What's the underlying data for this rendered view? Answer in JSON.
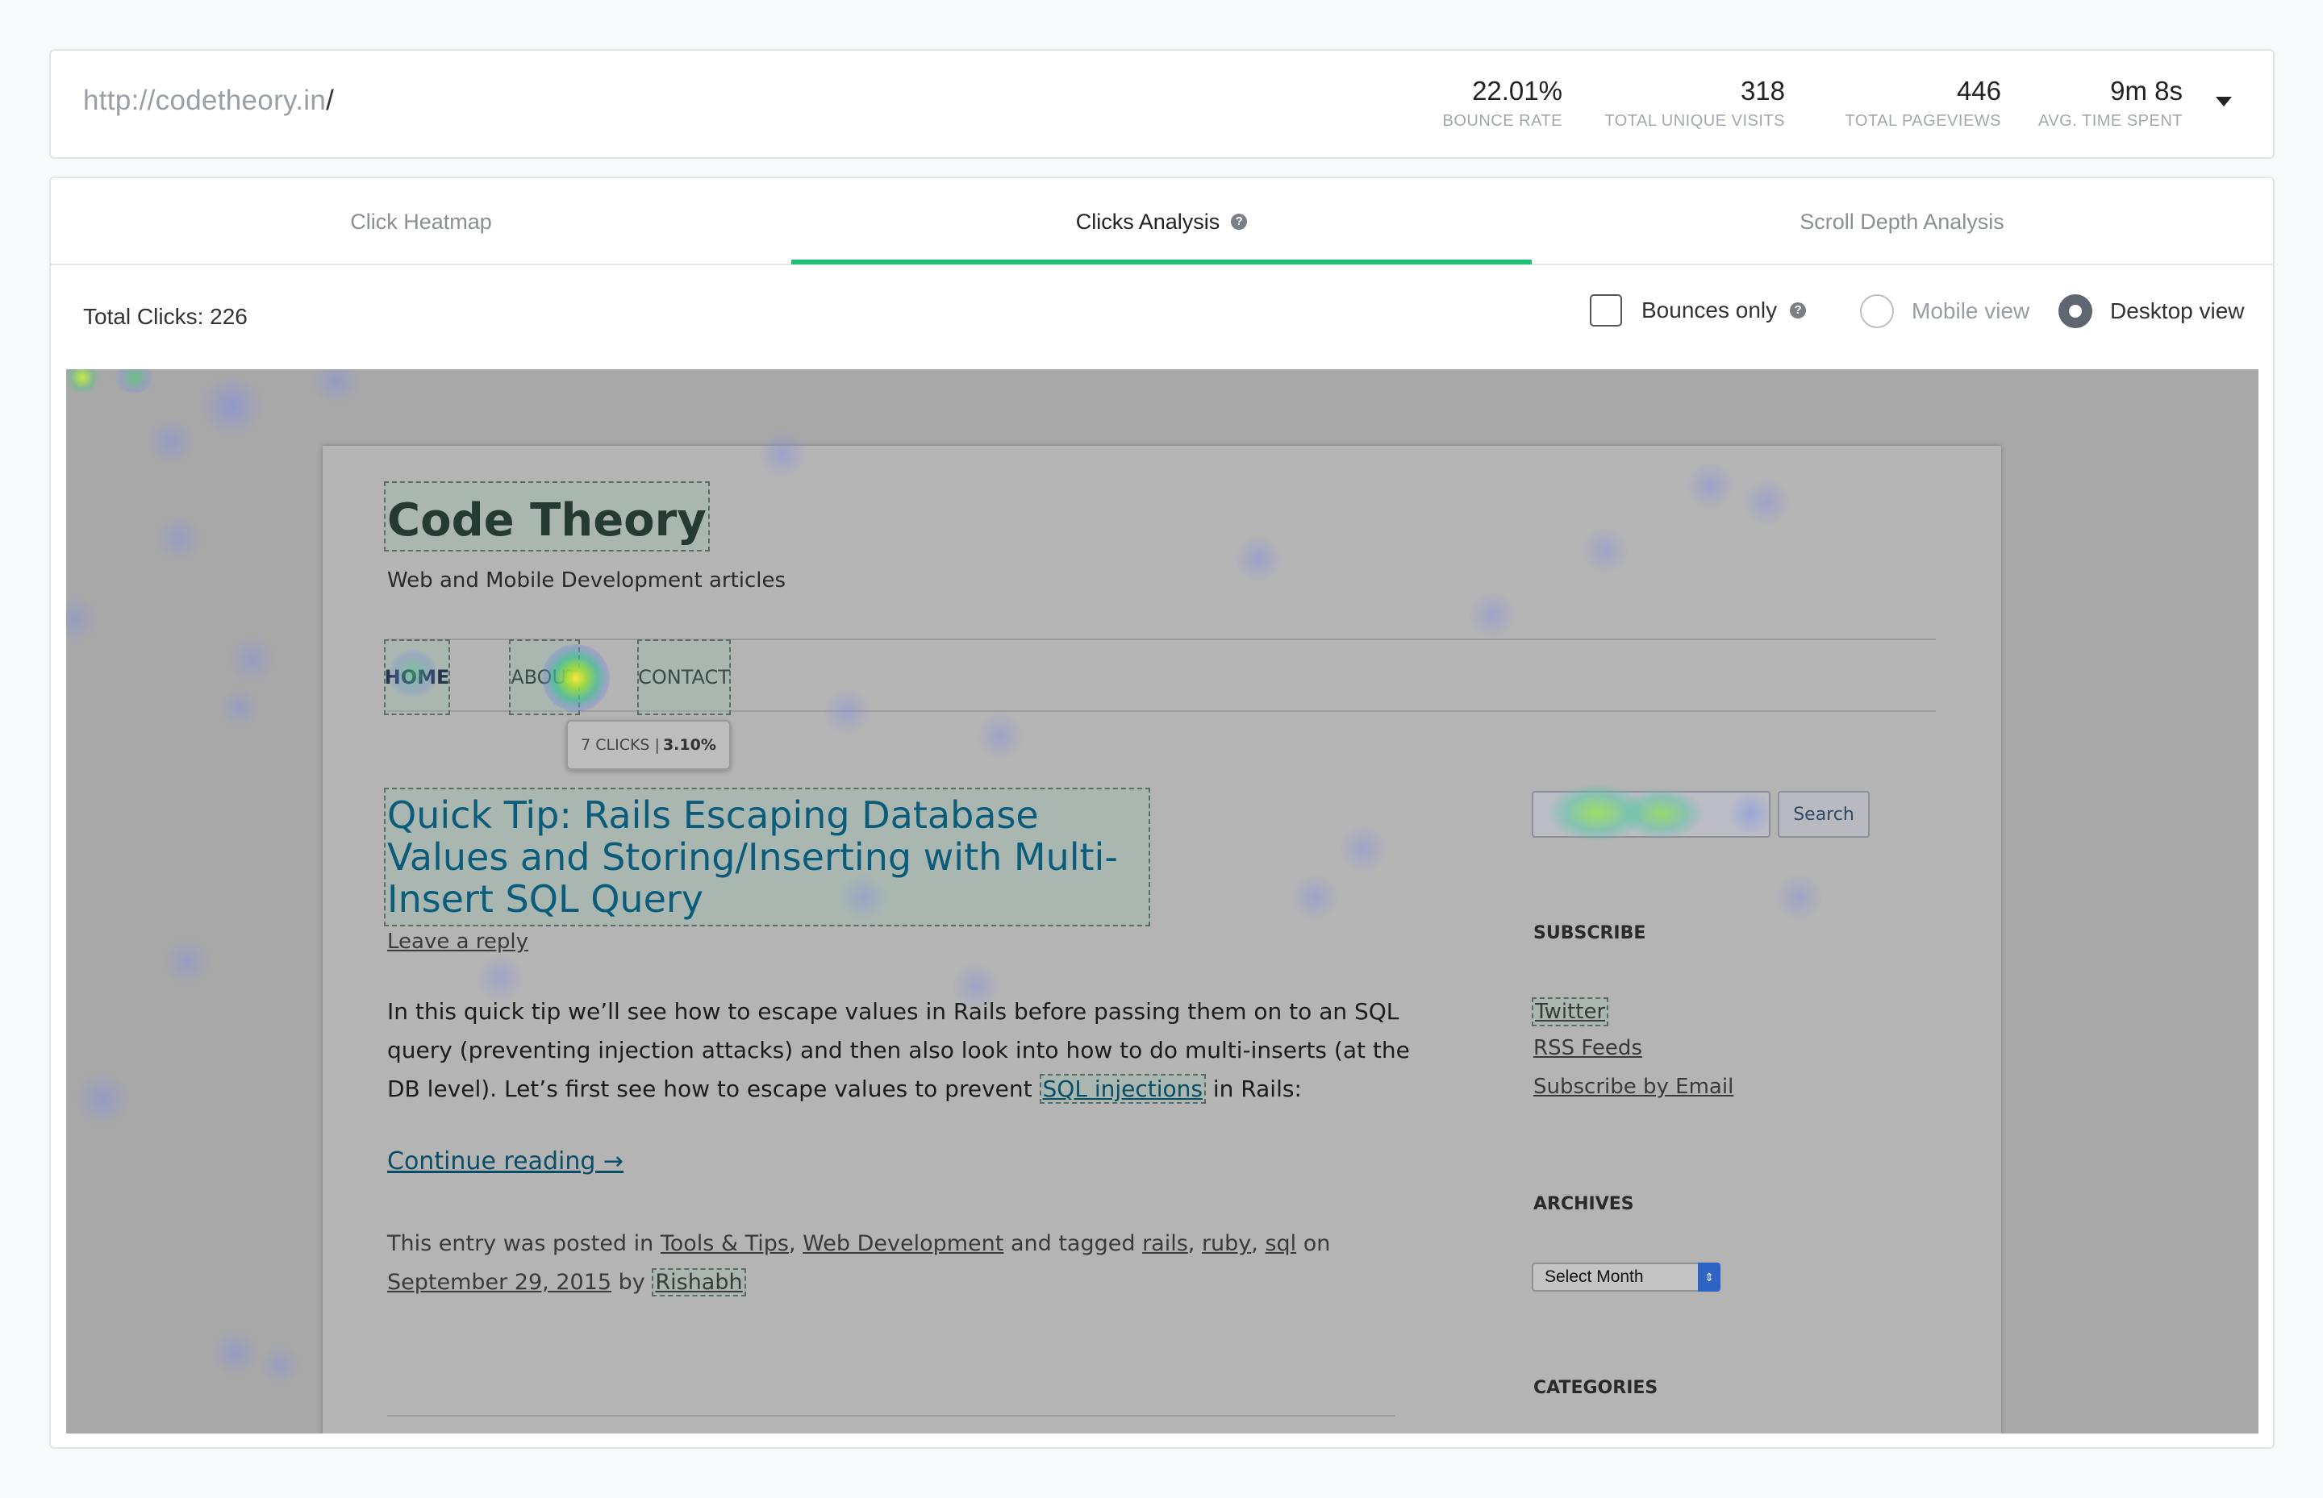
{
  "header": {
    "url_base": "http://codetheory.in",
    "url_path": "/",
    "stats": [
      {
        "value": "22.01%",
        "label": "BOUNCE RATE"
      },
      {
        "value": "318",
        "label": "TOTAL UNIQUE VISITS"
      },
      {
        "value": "446",
        "label": "TOTAL PAGEVIEWS"
      },
      {
        "value": "9m 8s",
        "label": "AVG. TIME SPENT"
      }
    ],
    "dropdown_icon": "caret-down-icon"
  },
  "tabs": [
    {
      "label": "Click Heatmap",
      "active": false
    },
    {
      "label": "Clicks Analysis",
      "active": true,
      "help": "?"
    },
    {
      "label": "Scroll Depth Analysis",
      "active": false
    }
  ],
  "accent_color": "#1fbf75",
  "controls": {
    "total_clicks": "Total Clicks: 226",
    "bounces_only": {
      "label": "Bounces only",
      "checked": false,
      "help": "?"
    },
    "view_mode": {
      "options": [
        "Mobile view",
        "Desktop view"
      ],
      "selected": "Desktop view"
    }
  },
  "site": {
    "title": "Code Theory",
    "description": "Web and Mobile Development articles",
    "nav": [
      "HOME",
      "ABOUT",
      "CONTACT"
    ],
    "tooltip": {
      "clicks": "7 CLICKS |",
      "percent": "3.10%"
    },
    "post": {
      "title": "Quick Tip: Rails Escaping Database Values and Storing/Inserting with Multi-Insert SQL Query",
      "leave_reply": "Leave a reply",
      "body_before": "In this quick tip we’ll see how to escape values in Rails before passing them on to an SQL query (preventing injection attacks) and then also look into how to do multi-inserts (at the DB level). Let’s first see how to escape values to prevent ",
      "body_link": "SQL injections",
      "body_after": " in Rails:",
      "continue": "Continue reading →",
      "meta": {
        "posted_in": "This entry was posted in ",
        "cat1": "Tools & Tips",
        "comma1": ", ",
        "cat2": "Web Development",
        "tagged": " and tagged ",
        "tag1": "rails",
        "comma2": ", ",
        "tag2": "ruby",
        "comma3": ", ",
        "tag3": "sql",
        "on": " on ",
        "date": "September 29, 2015",
        "by": " by ",
        "author": "Rishabh"
      }
    },
    "sidebar": {
      "search_button": "Search",
      "subscribe_title": "SUBSCRIBE",
      "subscribe_links": [
        "Twitter",
        "RSS Feeds",
        "Subscribe by Email"
      ],
      "archives_title": "ARCHIVES",
      "archives_select": "Select Month",
      "categories_title": "CATEGORIES"
    }
  }
}
